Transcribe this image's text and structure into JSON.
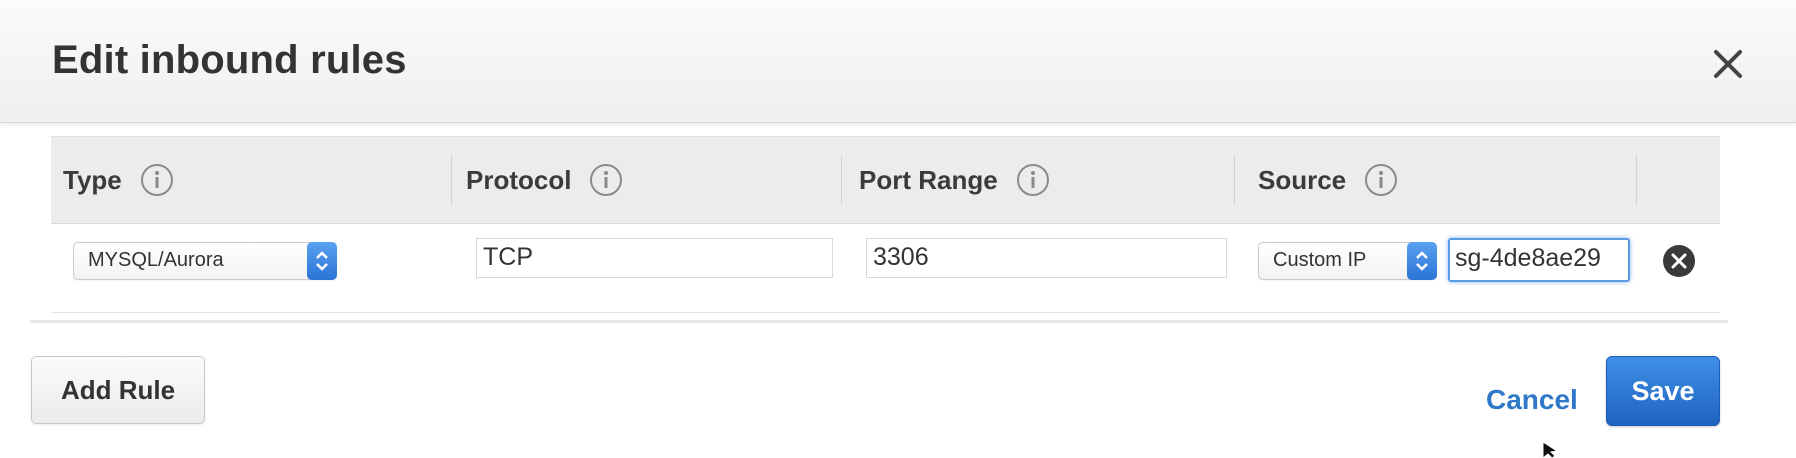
{
  "dialog": {
    "title": "Edit inbound rules",
    "close_icon": "close-icon"
  },
  "table": {
    "headers": [
      {
        "label": "Type",
        "icon": "info-icon"
      },
      {
        "label": "Protocol",
        "icon": "info-icon"
      },
      {
        "label": "Port Range",
        "icon": "info-icon"
      },
      {
        "label": "Source",
        "icon": "info-icon"
      }
    ],
    "rows": [
      {
        "type": "MYSQL/Aurora",
        "protocol": "TCP",
        "port_range": "3306",
        "source_type": "Custom IP",
        "source_value": "sg-4de8ae29",
        "remove_icon": "remove-circle-icon"
      }
    ]
  },
  "footer": {
    "add_rule_label": "Add Rule",
    "cancel_label": "Cancel",
    "save_label": "Save"
  },
  "colors": {
    "primary": "#2a70d2",
    "link": "#2f79c8",
    "focus": "#5b9be6"
  }
}
